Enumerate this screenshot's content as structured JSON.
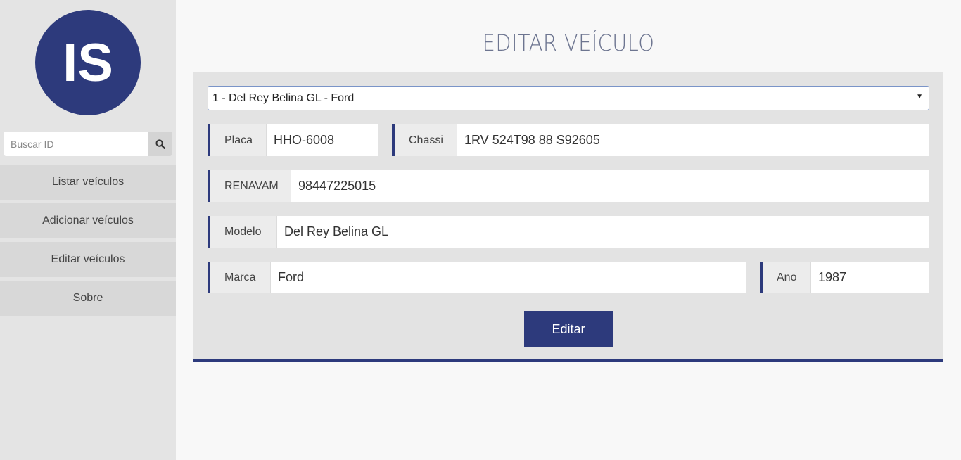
{
  "logo": {
    "text": "IS"
  },
  "search": {
    "placeholder": "Buscar ID",
    "icon": "search-icon"
  },
  "nav": {
    "items": [
      {
        "label": "Listar veículos"
      },
      {
        "label": "Adicionar veículos"
      },
      {
        "label": "Editar veículos"
      },
      {
        "label": "Sobre"
      }
    ]
  },
  "page": {
    "title": "EDITAR VEÍCULO"
  },
  "form": {
    "vehicle_select": {
      "selected": "1 - Del Rey Belina GL - Ford"
    },
    "placa": {
      "label": "Placa",
      "value": "HHO-6008"
    },
    "chassi": {
      "label": "Chassi",
      "value": "1RV 524T98 88 S92605"
    },
    "renavam": {
      "label": "RENAVAM",
      "value": "98447225015"
    },
    "modelo": {
      "label": "Modelo",
      "value": "Del Rey Belina GL"
    },
    "marca": {
      "label": "Marca",
      "value": "Ford"
    },
    "ano": {
      "label": "Ano",
      "value": "1987"
    },
    "submit_label": "Editar"
  },
  "colors": {
    "accent": "#2d3a7c",
    "sidebar": "#e4e4e4",
    "panel": "#e3e3e3"
  }
}
